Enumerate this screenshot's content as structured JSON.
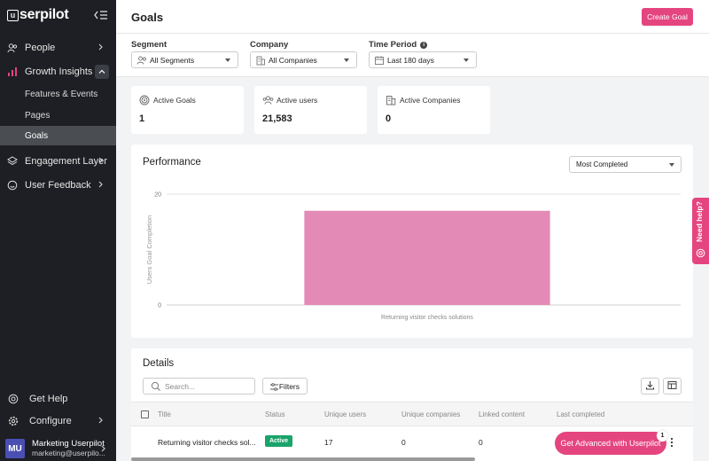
{
  "sidebar": {
    "logo": "serpilot",
    "logo_mark": "u",
    "items": [
      {
        "label": "People"
      },
      {
        "label": "Growth Insights"
      },
      {
        "label": "Engagement Layer"
      },
      {
        "label": "User Feedback"
      }
    ],
    "sub_items": [
      {
        "label": "Features & Events"
      },
      {
        "label": "Pages"
      },
      {
        "label": "Goals"
      }
    ],
    "bottom_items": [
      {
        "label": "Get Help"
      },
      {
        "label": "Configure"
      }
    ],
    "user": {
      "initials": "MU",
      "name": "Marketing Userpilot",
      "email": "marketing@userpilo..."
    }
  },
  "header": {
    "title": "Goals",
    "create_label": "Create Goal"
  },
  "filters": {
    "segment": {
      "label": "Segment",
      "value": "All Segments"
    },
    "company": {
      "label": "Company",
      "value": "All Companies"
    },
    "time_period": {
      "label": "Time Period",
      "value": "Last 180 days"
    }
  },
  "stats": [
    {
      "label": "Active Goals",
      "value": "1"
    },
    {
      "label": "Active users",
      "value": "21,583"
    },
    {
      "label": "Active Companies",
      "value": "0"
    }
  ],
  "performance": {
    "title": "Performance",
    "sort_value": "Most Completed"
  },
  "chart_data": {
    "type": "bar",
    "categories": [
      "Returning visitor checks solutions"
    ],
    "values": [
      17
    ],
    "ylabel": "Users Goal Completion",
    "xlabel": "",
    "ylim": [
      0,
      20
    ],
    "yticks": [
      "0",
      "20"
    ],
    "color": "#e48ab7",
    "grid": true
  },
  "details": {
    "title": "Details",
    "search_placeholder": "Search...",
    "filters_label": "Filters",
    "columns": [
      "Title",
      "Status",
      "Unique users",
      "Unique companies",
      "Linked content",
      "Last completed"
    ],
    "rows": [
      {
        "title": "Returning visitor checks sol...",
        "status": "Active",
        "unique_users": "17",
        "unique_companies": "0",
        "linked_content": "0",
        "last_completed": ""
      }
    ]
  },
  "floating": {
    "advanced_label": "Get Advanced with Userpilot",
    "advanced_badge": "1",
    "need_help": "Need help?"
  },
  "colors": {
    "accent": "#e5457f",
    "sidebar_bg": "#1d1f24",
    "active_badge": "#1aa36a",
    "bar": "#e48ab7"
  }
}
